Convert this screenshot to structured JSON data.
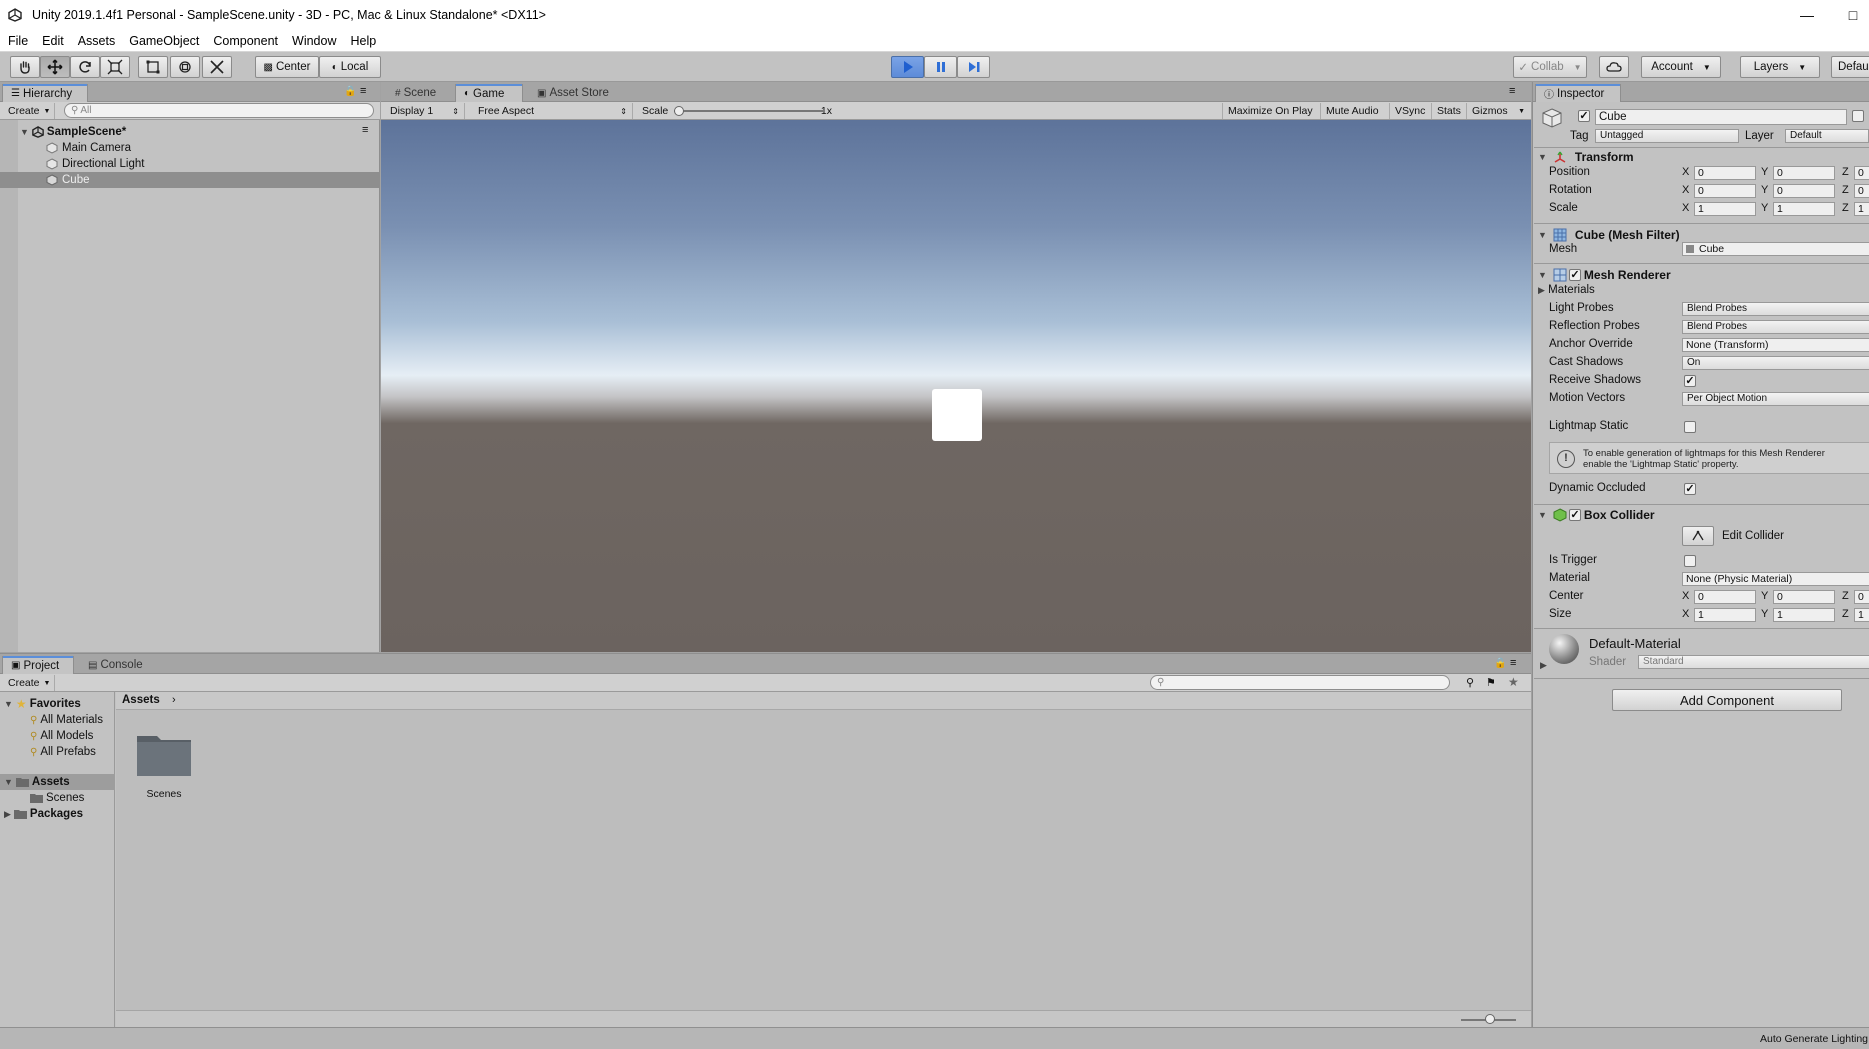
{
  "title_bar": {
    "title": "Unity 2019.1.4f1 Personal - SampleScene.unity - 3D - PC, Mac & Linux Standalone* <DX11>"
  },
  "menu": [
    "File",
    "Edit",
    "Assets",
    "GameObject",
    "Component",
    "Window",
    "Help"
  ],
  "toolbar": {
    "pivot_center": "Center",
    "pivot_local": "Local",
    "collab": "Collab",
    "account": "Account",
    "layers": "Layers",
    "layout": "Defau"
  },
  "hierarchy": {
    "tab": "Hierarchy",
    "create": "Create",
    "search_placeholder": "All",
    "scene": "SampleScene*",
    "items": [
      "Main Camera",
      "Directional Light",
      "Cube"
    ]
  },
  "view_tabs": [
    "Scene",
    "Game",
    "Asset Store"
  ],
  "game_bar": {
    "display": "Display 1",
    "aspect": "Free Aspect",
    "scale_label": "Scale",
    "scale_value": "1x",
    "buttons": [
      "Maximize On Play",
      "Mute Audio",
      "VSync",
      "Stats",
      "Gizmos"
    ]
  },
  "inspector": {
    "tab": "Inspector",
    "object_name": "Cube",
    "tag_label": "Tag",
    "tag_value": "Untagged",
    "layer_label": "Layer",
    "layer_value": "Default",
    "transform": {
      "title": "Transform",
      "rows": [
        {
          "label": "Position",
          "x": "0",
          "y": "0",
          "z": "0"
        },
        {
          "label": "Rotation",
          "x": "0",
          "y": "0",
          "z": "0"
        },
        {
          "label": "Scale",
          "x": "1",
          "y": "1",
          "z": "1"
        }
      ]
    },
    "mesh_filter": {
      "title": "Cube (Mesh Filter)",
      "mesh_label": "Mesh",
      "mesh_value": "Cube"
    },
    "mesh_renderer": {
      "title": "Mesh Renderer",
      "materials": "Materials",
      "light_probes_label": "Light Probes",
      "light_probes": "Blend Probes",
      "reflection_probes_label": "Reflection Probes",
      "reflection_probes": "Blend Probes",
      "anchor_override_label": "Anchor Override",
      "anchor_override": "None (Transform)",
      "cast_shadows_label": "Cast Shadows",
      "cast_shadows": "On",
      "receive_shadows_label": "Receive Shadows",
      "motion_vectors_label": "Motion Vectors",
      "motion_vectors": "Per Object Motion",
      "lightmap_static_label": "Lightmap Static",
      "info_line1": "To enable generation of lightmaps for this Mesh Renderer",
      "info_line2": "enable the 'Lightmap Static' property.",
      "dynamic_occluded_label": "Dynamic Occluded"
    },
    "box_collider": {
      "title": "Box Collider",
      "edit_collider": "Edit Collider",
      "is_trigger_label": "Is Trigger",
      "material_label": "Material",
      "material_value": "None (Physic Material)",
      "center_label": "Center",
      "center": {
        "x": "0",
        "y": "0",
        "z": "0"
      },
      "size_label": "Size",
      "size": {
        "x": "1",
        "y": "1",
        "z": "1"
      }
    },
    "material": {
      "name": "Default-Material",
      "shader_label": "Shader",
      "shader_value": "Standard"
    },
    "add_component": "Add Component"
  },
  "project": {
    "tabs": [
      "Project",
      "Console"
    ],
    "create": "Create",
    "favorites": "Favorites",
    "favorite_items": [
      "All Materials",
      "All Models",
      "All Prefabs"
    ],
    "assets": "Assets",
    "asset_children": [
      "Scenes"
    ],
    "packages": "Packages",
    "breadcrumb": "Assets",
    "grid_items": [
      "Scenes"
    ]
  },
  "status_bar": {
    "text": "Auto Generate Lighting"
  },
  "colors": {
    "accent": "#5b8ed9",
    "play_active": "#2f6fd6",
    "panel": "#c2c2c2",
    "sky_top": "#5c7399",
    "ground": "#6e6662"
  }
}
